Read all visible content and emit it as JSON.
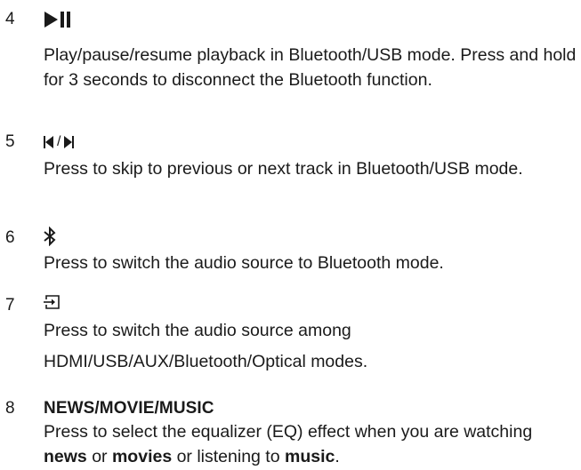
{
  "items": [
    {
      "number": "4",
      "icon": "play-pause-icon",
      "desc": "Play/pause/resume playback in Bluetooth/USB mode. Press and hold for 3 seconds to disconnect the Bluetooth function."
    },
    {
      "number": "5",
      "icon": "previous-next-track-icon",
      "icon_separator": "/",
      "desc": "Press to skip to previous or next track in Bluetooth/USB mode."
    },
    {
      "number": "6",
      "icon": "bluetooth-icon",
      "desc": "Press to switch the audio source to Bluetooth mode."
    },
    {
      "number": "7",
      "icon": "source-input-icon",
      "desc_line1": "Press to switch the audio source among",
      "desc_line2": "HDMI/USB/AUX/Bluetooth/Optical modes."
    },
    {
      "number": "8",
      "title": "NEWS/MOVIE/MUSIC",
      "desc_intro": "Press to select the equalizer (EQ) effect when you are watching ",
      "desc_news": "news",
      "desc_or1": " or ",
      "desc_movies": "movies",
      "desc_or2": " or listening to ",
      "desc_music": "music",
      "desc_end": "."
    }
  ]
}
